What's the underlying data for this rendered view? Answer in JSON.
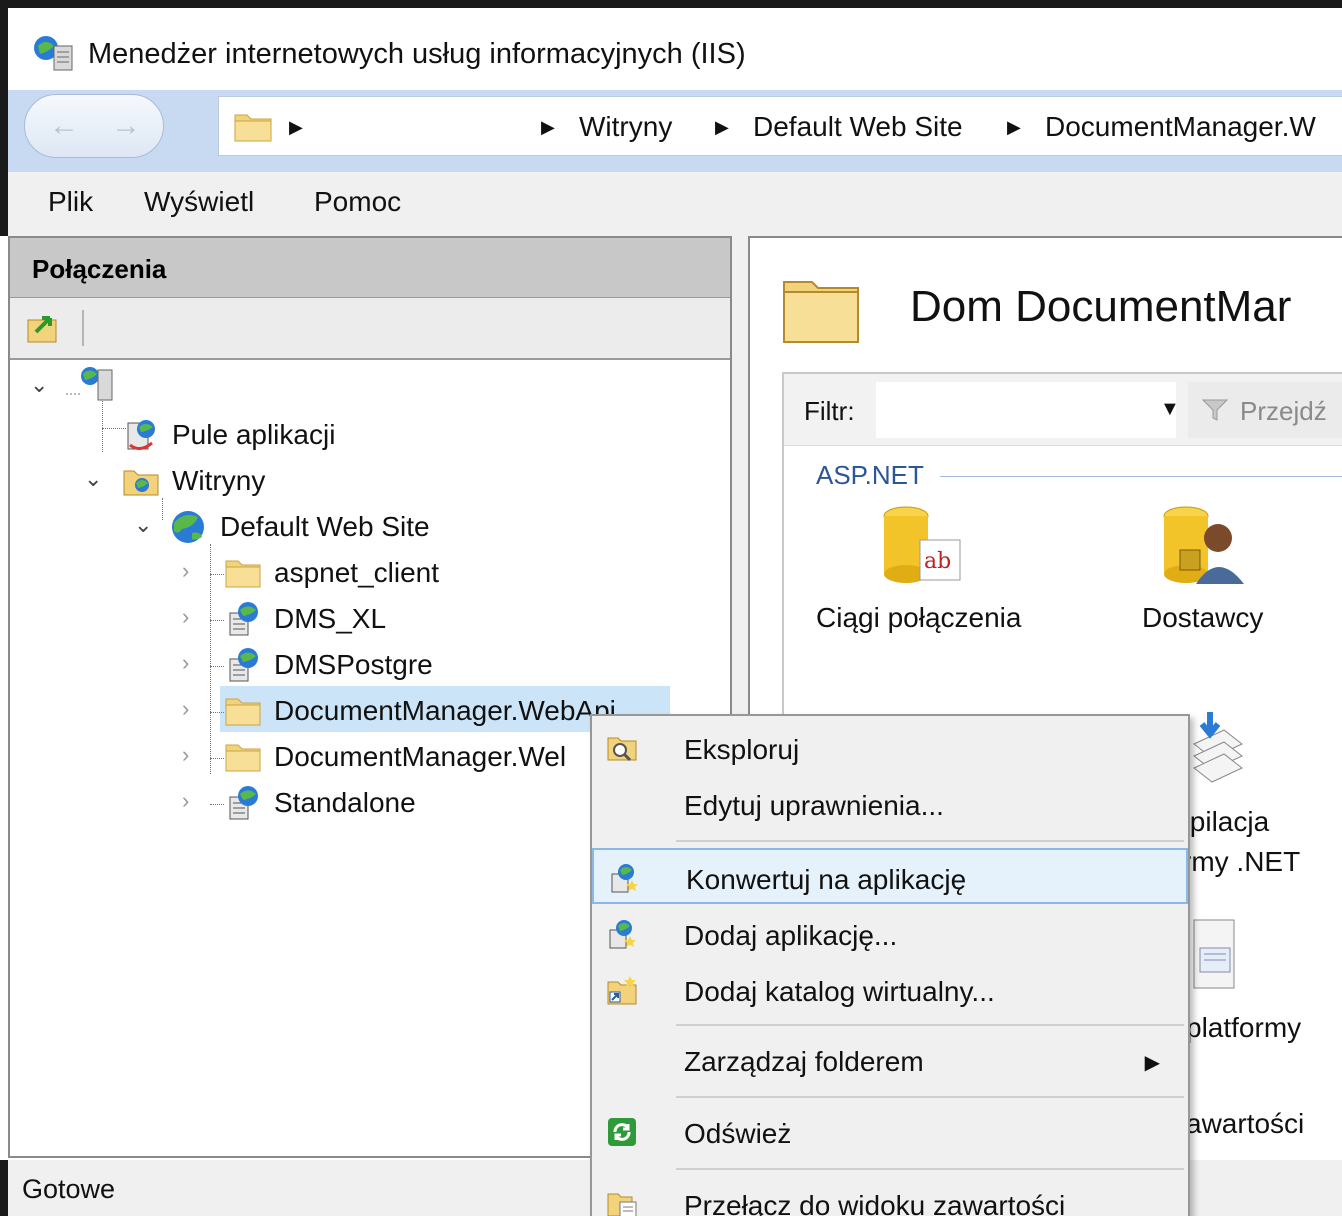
{
  "window": {
    "title": "Menedżer internetowych usług informacyjnych (IIS)"
  },
  "addressbar": {
    "back_icon": "←",
    "forward_icon": "→",
    "breadcrumbs": [
      "Witryny",
      "Default Web Site",
      "DocumentManager.W"
    ]
  },
  "menubar": {
    "items": [
      "Plik",
      "Wyświetl",
      "Pomoc"
    ]
  },
  "connections": {
    "header": "Połączenia",
    "tree": [
      {
        "label": "Pule aplikacji"
      },
      {
        "label": "Witryny"
      },
      {
        "label": "Default Web Site"
      },
      {
        "label": "aspnet_client"
      },
      {
        "label": "DMS_XL"
      },
      {
        "label": "DMSPostgre"
      },
      {
        "label": "DocumentManager.WebApi"
      },
      {
        "label": "DocumentManager.Wel"
      },
      {
        "label": "Standalone"
      }
    ],
    "selected_index": 6
  },
  "main": {
    "title": "Dom DocumentMar",
    "filter_label": "Filtr:",
    "filter_value": "",
    "go_label": "Przejdź",
    "group_label": "ASP.NET",
    "features": [
      {
        "label": "Ciągi połączenia"
      },
      {
        "label": "Dostawcy"
      },
      {
        "label": "ıpilacja"
      },
      {
        "label": "rmy .NET"
      },
      {
        "label": "platformy"
      },
      {
        "label": "awartości"
      }
    ]
  },
  "context_menu": {
    "items": [
      {
        "label": "Eksploruj",
        "icon": "explore-icon"
      },
      {
        "label": "Edytuj uprawnienia...",
        "icon": ""
      },
      {
        "label": "Konwertuj na aplikację",
        "icon": "convert-app-icon"
      },
      {
        "label": "Dodaj aplikację...",
        "icon": "add-app-icon"
      },
      {
        "label": "Dodaj katalog wirtualny...",
        "icon": "add-vdir-icon"
      },
      {
        "label": "Zarządzaj folderem",
        "icon": ""
      },
      {
        "label": "Odśwież",
        "icon": "refresh-icon"
      },
      {
        "label": "Przełącz do widoku zawartości",
        "icon": "content-view-icon"
      }
    ],
    "highlighted_index": 2,
    "submenu_arrow": "▶"
  },
  "statusbar": {
    "text": "Gotowe"
  },
  "colors": {
    "addressbar_bg": "#c7daf2",
    "selection_bg": "#cce4f7",
    "menu_highlight": "#e5f1fb",
    "group_label": "#2b5797"
  }
}
